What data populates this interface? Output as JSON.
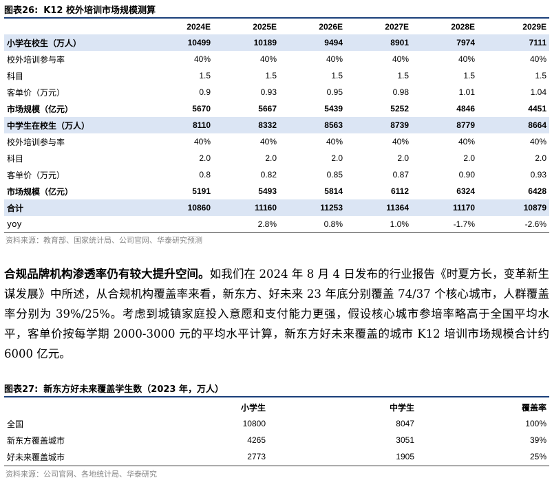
{
  "table26": {
    "label": "图表26:",
    "title": "K12 校外培训市场规模测算",
    "headers": [
      "",
      "2024E",
      "2025E",
      "2026E",
      "2027E",
      "2028E",
      "2029E"
    ],
    "rows": [
      {
        "style": "hl",
        "cells": [
          "小学在校生（万人）",
          "10499",
          "10189",
          "9494",
          "8901",
          "7974",
          "7111"
        ]
      },
      {
        "style": "",
        "cells": [
          "校外培训参与率",
          "40%",
          "40%",
          "40%",
          "40%",
          "40%",
          "40%"
        ]
      },
      {
        "style": "",
        "cells": [
          "科目",
          "1.5",
          "1.5",
          "1.5",
          "1.5",
          "1.5",
          "1.5"
        ]
      },
      {
        "style": "",
        "cells": [
          "客单价（万元）",
          "0.9",
          "0.93",
          "0.95",
          "0.98",
          "1.01",
          "1.04"
        ]
      },
      {
        "style": "bold",
        "cells": [
          "市场规模（亿元）",
          "5670",
          "5667",
          "5439",
          "5252",
          "4846",
          "4451"
        ]
      },
      {
        "style": "hl",
        "cells": [
          "中学生在校生（万人）",
          "8110",
          "8332",
          "8563",
          "8739",
          "8779",
          "8664"
        ]
      },
      {
        "style": "",
        "cells": [
          "校外培训参与率",
          "40%",
          "40%",
          "40%",
          "40%",
          "40%",
          "40%"
        ]
      },
      {
        "style": "",
        "cells": [
          "科目",
          "2.0",
          "2.0",
          "2.0",
          "2.0",
          "2.0",
          "2.0"
        ]
      },
      {
        "style": "",
        "cells": [
          "客单价（万元）",
          "0.8",
          "0.82",
          "0.85",
          "0.87",
          "0.90",
          "0.93"
        ]
      },
      {
        "style": "bold",
        "cells": [
          "市场规模（亿元）",
          "5191",
          "5493",
          "5814",
          "6112",
          "6324",
          "6428"
        ]
      },
      {
        "style": "hl",
        "cells": [
          "合计",
          "10860",
          "11160",
          "11253",
          "11364",
          "11170",
          "10879"
        ]
      },
      {
        "style": "line",
        "cells": [
          "yoy",
          "",
          "2.8%",
          "0.8%",
          "1.0%",
          "-1.7%",
          "-2.6%"
        ]
      }
    ],
    "source": "资料来源：教育部、国家统计局、公司官网、华泰研究预测"
  },
  "paragraph": {
    "lead": "合规品牌机构渗透率仍有较大提升空间。",
    "body": "如我们在 2024 年 8 月 4 日发布的行业报告《时夏方长，变革新生谋发展》中所述，从合规机构覆盖率来看，新东方、好未来 23 年底分别覆盖 74/37 个核心城市，人群覆盖率分别为 39%/25%。考虑到城镇家庭投入意愿和支付能力更强，假设核心城市参培率略高于全国平均水平，客单价按每学期 2000-3000 元的平均水平计算，新东方好未来覆盖的城市 K12 培训市场规模合计约 6000 亿元。"
  },
  "table27": {
    "label": "图表27:",
    "title": "新东方好未来覆盖学生数（2023 年，万人）",
    "headers": [
      "",
      "小学生",
      "中学生",
      "覆盖率"
    ],
    "rows": [
      {
        "cells": [
          "全国",
          "10800",
          "8047",
          "100%"
        ]
      },
      {
        "cells": [
          "新东方覆盖城市",
          "4265",
          "3051",
          "39%"
        ]
      },
      {
        "cells": [
          "好未来覆盖城市",
          "2773",
          "1905",
          "25%"
        ]
      }
    ],
    "source": "资料来源：公司官网、各地统计局、华泰研究"
  }
}
